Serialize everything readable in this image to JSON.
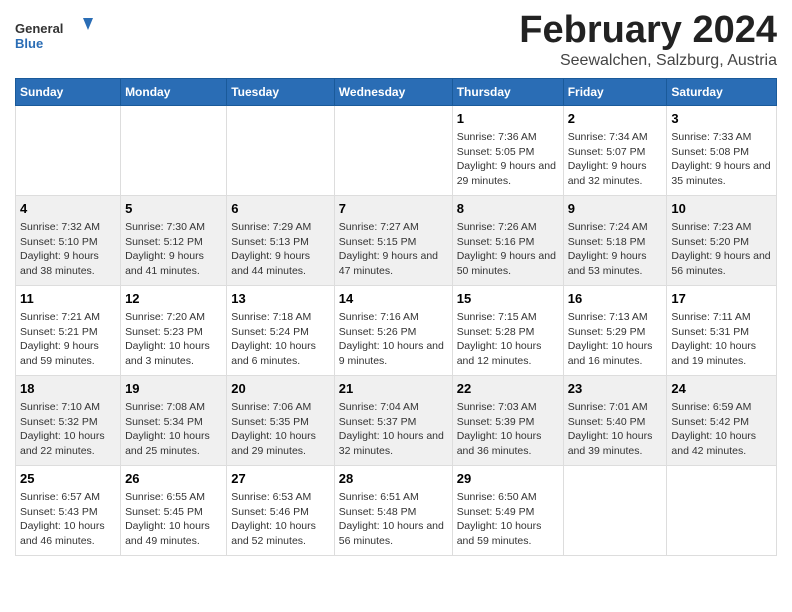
{
  "logo": {
    "general": "General",
    "blue": "Blue"
  },
  "title": "February 2024",
  "subtitle": "Seewalchen, Salzburg, Austria",
  "days_of_week": [
    "Sunday",
    "Monday",
    "Tuesday",
    "Wednesday",
    "Thursday",
    "Friday",
    "Saturday"
  ],
  "weeks": [
    {
      "group": 1,
      "days": [
        {
          "date": "",
          "info": ""
        },
        {
          "date": "",
          "info": ""
        },
        {
          "date": "",
          "info": ""
        },
        {
          "date": "",
          "info": ""
        },
        {
          "date": "1",
          "info": "Sunrise: 7:36 AM\nSunset: 5:05 PM\nDaylight: 9 hours and 29 minutes."
        },
        {
          "date": "2",
          "info": "Sunrise: 7:34 AM\nSunset: 5:07 PM\nDaylight: 9 hours and 32 minutes."
        },
        {
          "date": "3",
          "info": "Sunrise: 7:33 AM\nSunset: 5:08 PM\nDaylight: 9 hours and 35 minutes."
        }
      ]
    },
    {
      "group": 2,
      "days": [
        {
          "date": "4",
          "info": "Sunrise: 7:32 AM\nSunset: 5:10 PM\nDaylight: 9 hours and 38 minutes."
        },
        {
          "date": "5",
          "info": "Sunrise: 7:30 AM\nSunset: 5:12 PM\nDaylight: 9 hours and 41 minutes."
        },
        {
          "date": "6",
          "info": "Sunrise: 7:29 AM\nSunset: 5:13 PM\nDaylight: 9 hours and 44 minutes."
        },
        {
          "date": "7",
          "info": "Sunrise: 7:27 AM\nSunset: 5:15 PM\nDaylight: 9 hours and 47 minutes."
        },
        {
          "date": "8",
          "info": "Sunrise: 7:26 AM\nSunset: 5:16 PM\nDaylight: 9 hours and 50 minutes."
        },
        {
          "date": "9",
          "info": "Sunrise: 7:24 AM\nSunset: 5:18 PM\nDaylight: 9 hours and 53 minutes."
        },
        {
          "date": "10",
          "info": "Sunrise: 7:23 AM\nSunset: 5:20 PM\nDaylight: 9 hours and 56 minutes."
        }
      ]
    },
    {
      "group": 3,
      "days": [
        {
          "date": "11",
          "info": "Sunrise: 7:21 AM\nSunset: 5:21 PM\nDaylight: 9 hours and 59 minutes."
        },
        {
          "date": "12",
          "info": "Sunrise: 7:20 AM\nSunset: 5:23 PM\nDaylight: 10 hours and 3 minutes."
        },
        {
          "date": "13",
          "info": "Sunrise: 7:18 AM\nSunset: 5:24 PM\nDaylight: 10 hours and 6 minutes."
        },
        {
          "date": "14",
          "info": "Sunrise: 7:16 AM\nSunset: 5:26 PM\nDaylight: 10 hours and 9 minutes."
        },
        {
          "date": "15",
          "info": "Sunrise: 7:15 AM\nSunset: 5:28 PM\nDaylight: 10 hours and 12 minutes."
        },
        {
          "date": "16",
          "info": "Sunrise: 7:13 AM\nSunset: 5:29 PM\nDaylight: 10 hours and 16 minutes."
        },
        {
          "date": "17",
          "info": "Sunrise: 7:11 AM\nSunset: 5:31 PM\nDaylight: 10 hours and 19 minutes."
        }
      ]
    },
    {
      "group": 4,
      "days": [
        {
          "date": "18",
          "info": "Sunrise: 7:10 AM\nSunset: 5:32 PM\nDaylight: 10 hours and 22 minutes."
        },
        {
          "date": "19",
          "info": "Sunrise: 7:08 AM\nSunset: 5:34 PM\nDaylight: 10 hours and 25 minutes."
        },
        {
          "date": "20",
          "info": "Sunrise: 7:06 AM\nSunset: 5:35 PM\nDaylight: 10 hours and 29 minutes."
        },
        {
          "date": "21",
          "info": "Sunrise: 7:04 AM\nSunset: 5:37 PM\nDaylight: 10 hours and 32 minutes."
        },
        {
          "date": "22",
          "info": "Sunrise: 7:03 AM\nSunset: 5:39 PM\nDaylight: 10 hours and 36 minutes."
        },
        {
          "date": "23",
          "info": "Sunrise: 7:01 AM\nSunset: 5:40 PM\nDaylight: 10 hours and 39 minutes."
        },
        {
          "date": "24",
          "info": "Sunrise: 6:59 AM\nSunset: 5:42 PM\nDaylight: 10 hours and 42 minutes."
        }
      ]
    },
    {
      "group": 5,
      "days": [
        {
          "date": "25",
          "info": "Sunrise: 6:57 AM\nSunset: 5:43 PM\nDaylight: 10 hours and 46 minutes."
        },
        {
          "date": "26",
          "info": "Sunrise: 6:55 AM\nSunset: 5:45 PM\nDaylight: 10 hours and 49 minutes."
        },
        {
          "date": "27",
          "info": "Sunrise: 6:53 AM\nSunset: 5:46 PM\nDaylight: 10 hours and 52 minutes."
        },
        {
          "date": "28",
          "info": "Sunrise: 6:51 AM\nSunset: 5:48 PM\nDaylight: 10 hours and 56 minutes."
        },
        {
          "date": "29",
          "info": "Sunrise: 6:50 AM\nSunset: 5:49 PM\nDaylight: 10 hours and 59 minutes."
        },
        {
          "date": "",
          "info": ""
        },
        {
          "date": "",
          "info": ""
        }
      ]
    }
  ]
}
